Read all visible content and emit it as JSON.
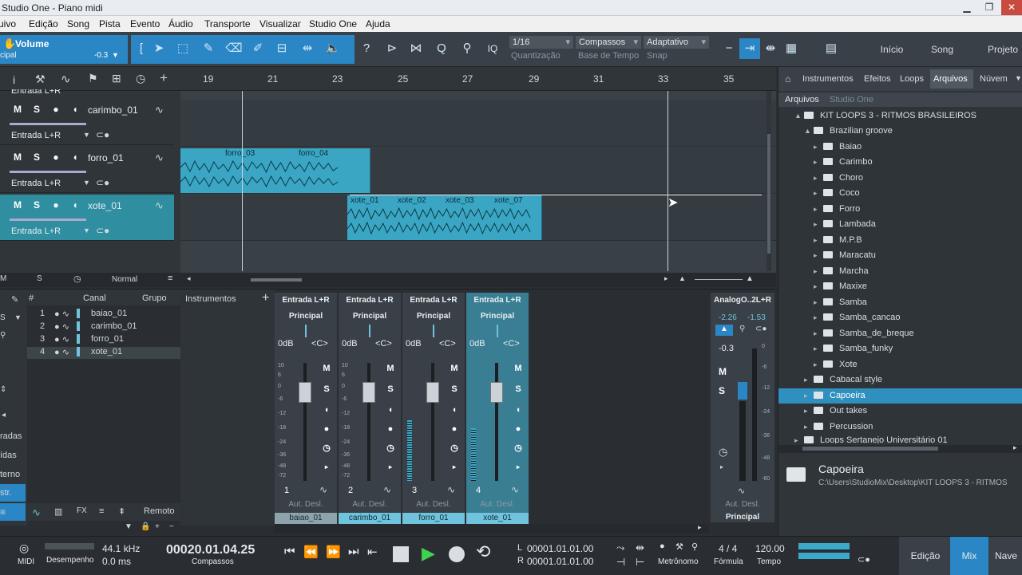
{
  "window": {
    "title": "Studio One - Piano midi"
  },
  "menu": [
    "uivo",
    "Edição",
    "Song",
    "Pista",
    "Evento",
    "Áudio",
    "Transporte",
    "Visualizar",
    "Studio One",
    "Ajuda"
  ],
  "toolbar": {
    "param_label": "Volume",
    "param_sub": "cipal",
    "param_value": "-0.3",
    "quant_value": "1/16",
    "quant_label": "Quantização",
    "timebase_value": "Compassos",
    "timebase_label": "Base de Tempo",
    "snap_value": "Adaptativo",
    "snap_label": "Snap",
    "nav": [
      "Início",
      "Song",
      "Projeto"
    ],
    "iq": "IQ"
  },
  "ruler": {
    "numbers": [
      "19",
      "21",
      "23",
      "25",
      "27",
      "29",
      "31",
      "33",
      "35"
    ]
  },
  "tracks": [
    {
      "name": "carimbo_01",
      "input": "Entrada L+R",
      "m": "M",
      "s": "S"
    },
    {
      "name": "forro_01",
      "input": "Entrada L+R",
      "m": "M",
      "s": "S"
    },
    {
      "name": "xote_01",
      "input": "Entrada L+R",
      "m": "M",
      "s": "S"
    }
  ],
  "top_track_input": "Entrada L+R",
  "clips": {
    "forro": [
      "forro_03",
      "forro_04"
    ],
    "xote": [
      "xote_01",
      "xote_02",
      "xote_03",
      "xote_07"
    ]
  },
  "track_footer": {
    "m": "M",
    "s": "S",
    "mode": "Normal"
  },
  "chanlist": {
    "headers": {
      "num": "#",
      "channel": "Canal",
      "group": "Grupo"
    },
    "rows": [
      {
        "n": "1",
        "name": "baiao_01"
      },
      {
        "n": "2",
        "name": "carimbo_01"
      },
      {
        "n": "3",
        "name": "forro_01"
      },
      {
        "n": "4",
        "name": "xote_01"
      }
    ],
    "side": [
      "radas",
      "ídas",
      "terno",
      "str."
    ],
    "remote": "Remoto",
    "instruments": "Instrumentos"
  },
  "mixer": {
    "channels": [
      {
        "input": "Entrada L+R",
        "out": "Principal",
        "db": "0dB",
        "pan": "<C>",
        "num": "1",
        "aut": "Aut. Desl.",
        "name": "baiao_01"
      },
      {
        "input": "Entrada L+R",
        "out": "Principal",
        "db": "0dB",
        "pan": "<C>",
        "num": "2",
        "aut": "Aut. Desl.",
        "name": "carimbo_01"
      },
      {
        "input": "Entrada L+R",
        "out": "Principal",
        "db": "0dB",
        "pan": "<C>",
        "num": "3",
        "aut": "Aut. Desl.",
        "name": "forro_01"
      },
      {
        "input": "Entrada L+R",
        "out": "Principal",
        "db": "0dB",
        "pan": "<C>",
        "num": "4",
        "aut": "Aut. Desl.",
        "name": "xote_01"
      }
    ],
    "scale": [
      "10",
      "6",
      "0",
      "-6",
      "-12",
      "-18",
      "-24",
      "-36",
      "-48",
      "-72"
    ],
    "master": {
      "input": "AnalogO..2L+R",
      "l": "-2.26",
      "r": "-1.53",
      "value": "-0.3",
      "aut": "Aut. Desl.",
      "name": "Principal",
      "scale": [
        "0",
        "-6",
        "-12",
        "-24",
        "-36",
        "-48",
        "-60"
      ]
    },
    "btn": {
      "m": "M",
      "s": "S"
    }
  },
  "browser": {
    "tabs": [
      "Instrumentos",
      "Efeitos",
      "Loops",
      "Arquivos",
      "Núvem"
    ],
    "path": [
      "Arquivos",
      "Studio One"
    ],
    "root": "KIT LOOPS 3 - RITMOS BRASILEIROS",
    "group": "Brazilian groove",
    "items": [
      "Baiao",
      "Carimbo",
      "Choro",
      "Coco",
      "Forro",
      "Lambada",
      "M.P.B",
      "Maracatu",
      "Marcha",
      "Maxixe",
      "Samba",
      "Samba_cancao",
      "Samba_de_breque",
      "Samba_funky",
      "Xote"
    ],
    "siblings": [
      "Cabacal style",
      "Capoeira",
      "Out takes",
      "Percussion"
    ],
    "clipped": "Loops Sertanejo Universitário 01",
    "selected_name": "Capoeira",
    "selected_path": "C:\\Users\\StudioMix\\Desktop\\KIT LOOPS 3 - RITMOS"
  },
  "transport": {
    "midi": "MIDI",
    "perf": "Desempenho",
    "rate": "44.1 kHz",
    "latency": "0.0 ms",
    "position": "00020.01.04.25",
    "pos_label": "Compassos",
    "L": "L",
    "R": "R",
    "loc_l": "00001.01.01.00",
    "loc_r": "00001.01.01.00",
    "metro": "Metrônomo",
    "sig": "4 / 4",
    "sig_label": "Fórmula",
    "tempo": "120.00",
    "tempo_label": "Tempo",
    "tabs": [
      "Edição",
      "Mix",
      "Nave"
    ]
  },
  "colors": {
    "accent": "#2b86c5",
    "clip": "#3aa6c4",
    "track_active": "#2f8fa0"
  }
}
